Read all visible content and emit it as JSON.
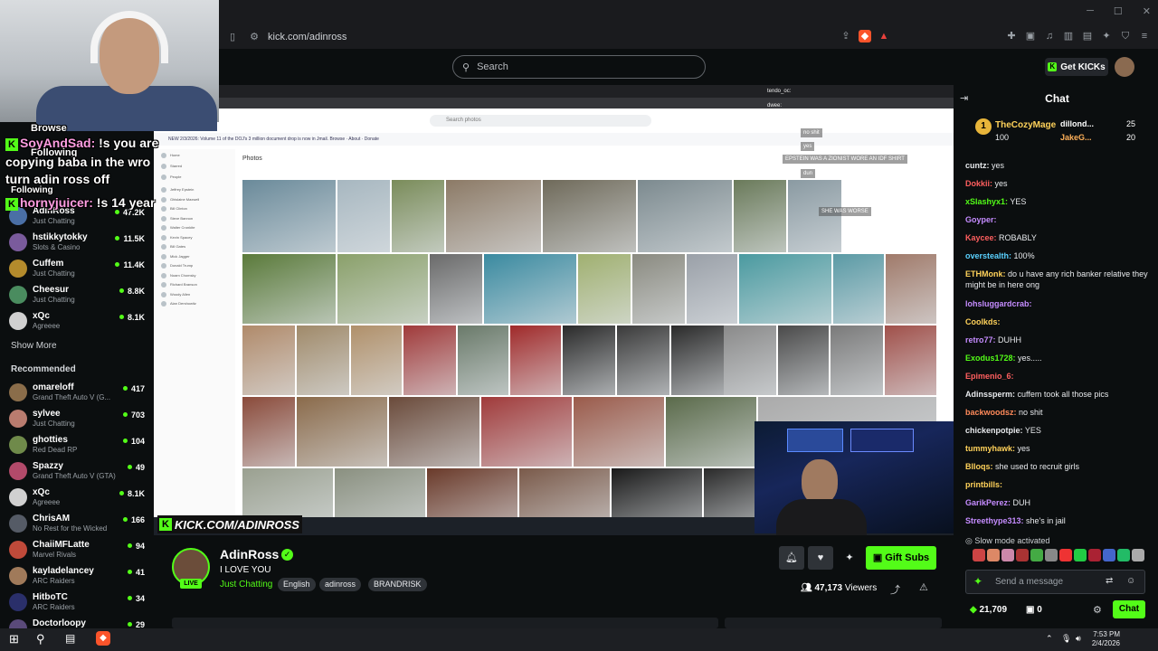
{
  "browser": {
    "url": "kick.com/adinross"
  },
  "header": {
    "search_placeholder": "Search",
    "get_kicks": "Get KICKs"
  },
  "webcam_overlay": {
    "browse": "Browse",
    "following": "Following",
    "following2": "Following",
    "chat_line1_user": "SoyAndSad:",
    "chat_line1_text": "!s you are",
    "chat_line2": "copying baba in the wro",
    "chat_line3": "turn adin ross off",
    "chat_line4_user": "hornyjuicer:",
    "chat_line4_text": "!s 14 year"
  },
  "sidebar": {
    "following": [
      {
        "name": "AdinRoss",
        "category": "Just Chatting",
        "viewers": "47.2K",
        "color": "#4a6fa5"
      },
      {
        "name": "hstikkytokky",
        "category": "Slots & Casino",
        "viewers": "11.5K",
        "color": "#7a5b9c"
      },
      {
        "name": "Cuffem",
        "category": "Just Chatting",
        "viewers": "11.4K",
        "color": "#b48b2c"
      },
      {
        "name": "Cheesur",
        "category": "Just Chatting",
        "viewers": "8.8K",
        "color": "#4a8c5f"
      },
      {
        "name": "xQc",
        "category": "Agreeee",
        "viewers": "8.1K",
        "color": "#d0d0d0"
      }
    ],
    "show_more": "Show More",
    "recommended_title": "Recommended",
    "recommended": [
      {
        "name": "omareloff",
        "category": "Grand Theft Auto V (G...",
        "viewers": "417",
        "color": "#8a6d4a"
      },
      {
        "name": "sylvee",
        "category": "Just Chatting",
        "viewers": "703",
        "color": "#b97c6f"
      },
      {
        "name": "ghotties",
        "category": "Red Dead RP",
        "viewers": "104",
        "color": "#6f8a4a"
      },
      {
        "name": "Spazzy",
        "category": "Grand Theft Auto V (GTA)",
        "viewers": "49",
        "color": "#b24a6a"
      },
      {
        "name": "xQc",
        "category": "Agreeee",
        "viewers": "8.1K",
        "color": "#d0d0d0"
      },
      {
        "name": "ChrisAM",
        "category": "No Rest for the Wicked",
        "viewers": "166",
        "color": "#555b66"
      },
      {
        "name": "ChaiiMFLatte",
        "category": "Marvel Rivals",
        "viewers": "94",
        "color": "#c04a3a"
      },
      {
        "name": "kayladelancey",
        "category": "ARC Raiders",
        "viewers": "41",
        "color": "#a07a5a"
      },
      {
        "name": "HitboTC",
        "category": "ARC Raiders",
        "viewers": "34",
        "color": "#2a2f6a"
      },
      {
        "name": "Doctorloopy",
        "category": "",
        "viewers": "29",
        "color": "#5a4a7a"
      }
    ]
  },
  "video": {
    "watermark": "KICK.COM/ADINROSS",
    "inner_search": "Search photos",
    "inner_photos_heading": "Photos",
    "inner_banner": "NEW 2/3/2026: Volume 11 of the DOJ's 3 million document drop is now in Jmail. Browse · About · Donate",
    "inner_sidebar": [
      "Home",
      "Starred",
      "People",
      "Jeffrey Epstein",
      "Ghislaine Maxwell",
      "Bill Clinton",
      "Steve Bannon",
      "Walter Cronkite",
      "Kevin Spacey",
      "Bill Gates",
      "Mick Jagger",
      "Donald Trump",
      "Noam Chomsky",
      "Richard Branson",
      "Woody Allen",
      "Alan Dershowitz"
    ],
    "overlay_chat": [
      "tendo_oc:",
      "dwee:",
      "no shit",
      "yes",
      "EPSTEIN WAS A ZIONIST WORE AN IDF SHIRT",
      "dun",
      "SHE WAS WORSE"
    ]
  },
  "channel": {
    "name": "AdinRoss",
    "title": "I LOVE YOU",
    "category": "Just Chatting",
    "tags": [
      "English",
      "adinross",
      "BRANDRISK"
    ],
    "live_label": "LIVE",
    "gift_subs": "Gift Subs",
    "viewers": "47,173",
    "viewers_label": "Viewers"
  },
  "chat": {
    "title": "Chat",
    "pinned": {
      "user": "TheCozyMage",
      "amount": "100",
      "rank": "1",
      "others": [
        {
          "name": "dillond...",
          "value": "25"
        },
        {
          "name": "JakeG...",
          "value": "20"
        }
      ]
    },
    "messages": [
      {
        "user": "cuntz:",
        "text": "yes",
        "color": "#e8eaed"
      },
      {
        "user": "Dokkii:",
        "text": "yes",
        "color": "#ff5f5f"
      },
      {
        "user": "xSlashyx1:",
        "text": "YES",
        "color": "#53fc18"
      },
      {
        "user": "Goyper:",
        "text": "",
        "color": "#c58cff"
      },
      {
        "user": "Kaycee:",
        "text": "ROBABLY",
        "color": "#ff5f5f"
      },
      {
        "user": "overstealth:",
        "text": "100%",
        "color": "#5ad1ff"
      },
      {
        "user": "ETHMonk:",
        "text": "do u have any rich banker relative they might be in here ong",
        "color": "#ffd25a"
      },
      {
        "user": "lohsluggardcrab:",
        "text": "",
        "color": "#c58cff"
      },
      {
        "user": "Coolkds:",
        "text": "",
        "color": "#ffd25a"
      },
      {
        "user": "retro77:",
        "text": "DUHH",
        "color": "#c58cff"
      },
      {
        "user": "Exodus1728:",
        "text": "yes.....",
        "color": "#53fc18"
      },
      {
        "user": "Epimenio_6:",
        "text": "",
        "color": "#ff5f5f"
      },
      {
        "user": "Adinssperm:",
        "text": "cuffem took all those pics",
        "color": "#e8eaed"
      },
      {
        "user": "backwoodsz:",
        "text": "no shit",
        "color": "#ff8a5a"
      },
      {
        "user": "chickenpotpie:",
        "text": "YES",
        "color": "#e8eaed"
      },
      {
        "user": "tummyhawk:",
        "text": "yes",
        "color": "#ffd25a"
      },
      {
        "user": "Blloqs:",
        "text": "she used to recruit girls",
        "color": "#ffd25a"
      },
      {
        "user": "printbills:",
        "text": "",
        "color": "#ffd25a"
      },
      {
        "user": "GarikPerez:",
        "text": "DUH",
        "color": "#c58cff"
      },
      {
        "user": "Streethype313:",
        "text": "she's in jail",
        "color": "#c58cff"
      }
    ],
    "slow_mode": "Slow mode activated",
    "input_placeholder": "Send a message",
    "kicks": "21,709",
    "gifts": "0",
    "chat_button": "Chat"
  },
  "taskbar": {
    "time": "7:53 PM",
    "date": "2/4/2026"
  }
}
